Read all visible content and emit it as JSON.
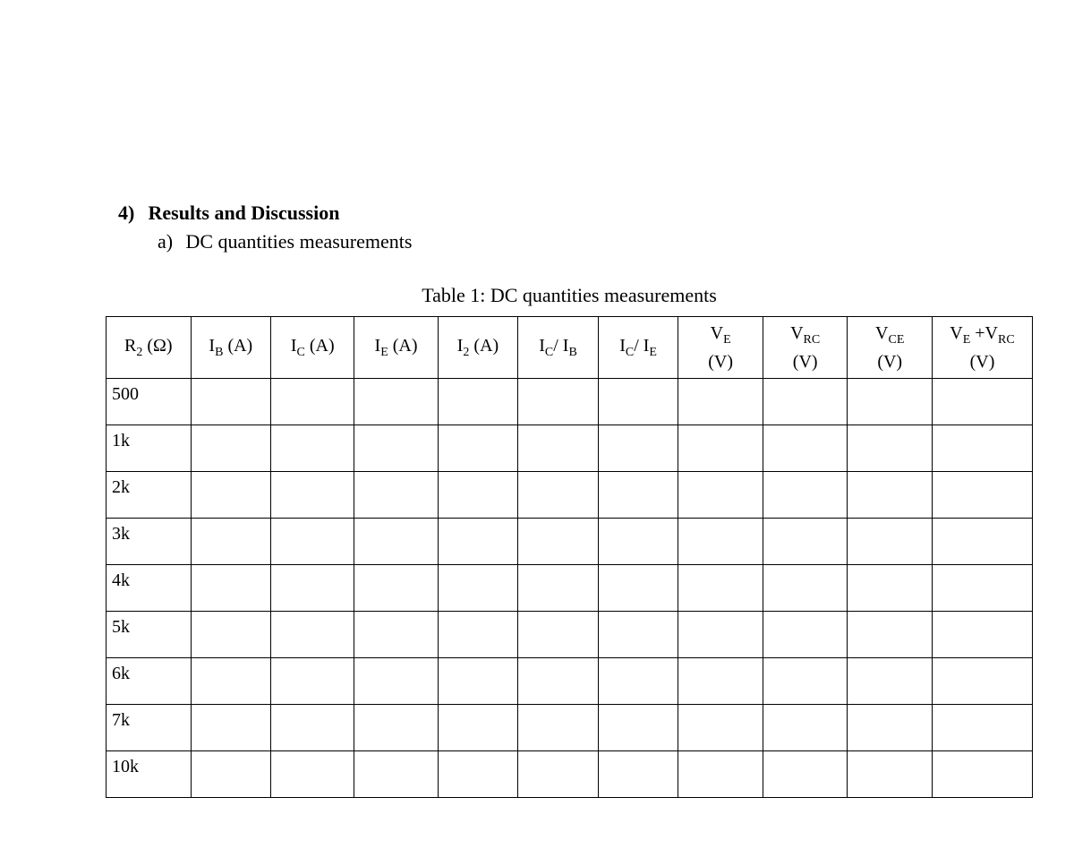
{
  "section": {
    "number": "4)",
    "title": "Results and Discussion",
    "sub_letter": "a)",
    "sub_title": "DC quantities measurements"
  },
  "table": {
    "caption": "Table 1: DC quantities measurements",
    "headers_html": [
      "R<sub>2</sub> (Ω)",
      "I<sub>B</sub> (A)",
      "I<sub>C</sub> (A)",
      "I<sub>E</sub> (A)",
      "I<sub>2</sub> (A)",
      "I<sub>C</sub>/ I<sub>B</sub>",
      "I<sub>C</sub>/ I<sub>E</sub>",
      "V<sub>E</sub><br>(V)",
      "V<sub>RC</sub><br>(V)",
      "V<sub>CE</sub><br>(V)",
      "V<sub>E</sub> +V<sub>RC</sub><br>(V)"
    ],
    "rows": [
      {
        "r2": "500"
      },
      {
        "r2": "1k"
      },
      {
        "r2": "2k"
      },
      {
        "r2": "3k"
      },
      {
        "r2": "4k"
      },
      {
        "r2": "5k"
      },
      {
        "r2": "6k"
      },
      {
        "r2": "7k"
      },
      {
        "r2": "10k"
      }
    ]
  },
  "chart_data": {
    "type": "table",
    "title": "Table 1: DC quantities measurements",
    "columns": [
      "R2 (Ω)",
      "IB (A)",
      "IC (A)",
      "IE (A)",
      "I2 (A)",
      "IC/IB",
      "IC/IE",
      "VE (V)",
      "VRC (V)",
      "VCE (V)",
      "VE+VRC (V)"
    ],
    "rows": [
      [
        "500",
        "",
        "",
        "",
        "",
        "",
        "",
        "",
        "",
        "",
        ""
      ],
      [
        "1k",
        "",
        "",
        "",
        "",
        "",
        "",
        "",
        "",
        "",
        ""
      ],
      [
        "2k",
        "",
        "",
        "",
        "",
        "",
        "",
        "",
        "",
        "",
        ""
      ],
      [
        "3k",
        "",
        "",
        "",
        "",
        "",
        "",
        "",
        "",
        "",
        ""
      ],
      [
        "4k",
        "",
        "",
        "",
        "",
        "",
        "",
        "",
        "",
        "",
        ""
      ],
      [
        "5k",
        "",
        "",
        "",
        "",
        "",
        "",
        "",
        "",
        "",
        ""
      ],
      [
        "6k",
        "",
        "",
        "",
        "",
        "",
        "",
        "",
        "",
        "",
        ""
      ],
      [
        "7k",
        "",
        "",
        "",
        "",
        "",
        "",
        "",
        "",
        "",
        ""
      ],
      [
        "10k",
        "",
        "",
        "",
        "",
        "",
        "",
        "",
        "",
        "",
        ""
      ]
    ]
  }
}
